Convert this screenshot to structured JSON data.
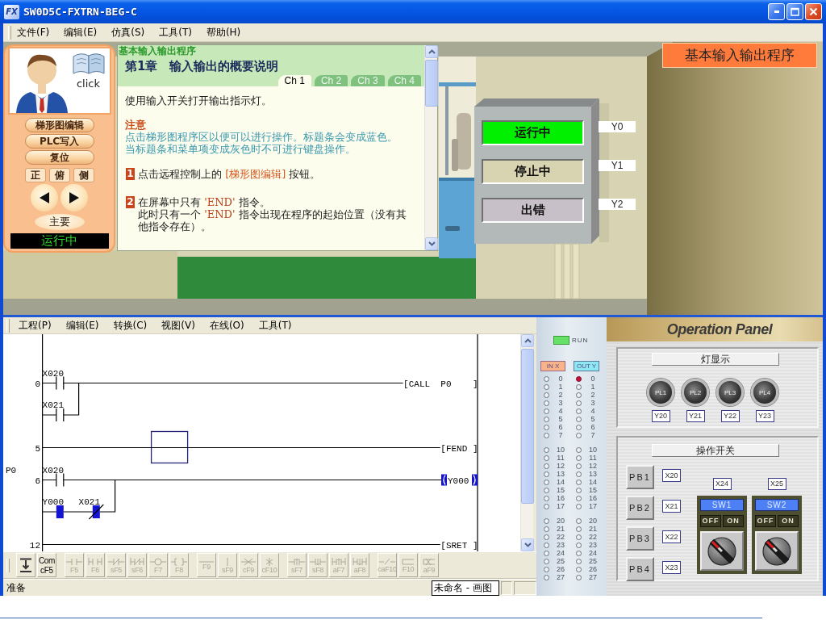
{
  "window": {
    "logo": "FX",
    "title": "SW0D5C-FXTRN-BEG-C"
  },
  "menu": [
    "文件(F)",
    "编辑(E)",
    "仿真(S)",
    "工具(T)",
    "帮助(H)"
  ],
  "remote": {
    "caption": "click",
    "buttons": [
      "梯形图编辑",
      "PLC写入",
      "复位"
    ],
    "views": [
      "正",
      "俯",
      "侧"
    ],
    "nav": [
      {
        "kind": "back"
      },
      {
        "kind": "forward"
      }
    ],
    "main_button": "主要",
    "status": "运行中"
  },
  "guide": {
    "section": "基本输入输出程序",
    "title": "第1章　输入输出的概要说明",
    "tabs": [
      {
        "label": "Ch 1",
        "selected": true
      },
      {
        "label": "Ch 2",
        "selected": false
      },
      {
        "label": "Ch 3",
        "selected": false
      },
      {
        "label": "Ch 4",
        "selected": false
      }
    ],
    "intro": "使用输入开关打开输出指示灯。",
    "note": {
      "heading": "注意",
      "lines": [
        "点击梯形图程序区以便可以进行操作。标题条会变成蓝色。",
        "当标题条和菜单项变成灰色时不可进行键盘操作。"
      ]
    },
    "steps": [
      {
        "number": "1",
        "paragraphs": [
          [
            {
              "kind": "plain",
              "text": "点击远程控制上的 "
            },
            {
              "kind": "button",
              "text": "[梯形图编辑]"
            },
            {
              "kind": "plain",
              "text": " 按钮。"
            }
          ]
        ]
      },
      {
        "number": "2",
        "paragraphs": [
          [
            {
              "kind": "plain",
              "text": "在屏幕中只有 "
            },
            {
              "kind": "code",
              "text": "'END'"
            },
            {
              "kind": "plain",
              "text": " 指令。"
            }
          ],
          [
            {
              "kind": "plain",
              "text": "此时只有一个 "
            },
            {
              "kind": "code",
              "text": "'END'"
            },
            {
              "kind": "plain",
              "text": " 指令出现在程序的起始位置（没有其他指令存在）。"
            }
          ]
        ]
      }
    ]
  },
  "scene": {
    "badge": "基本输入输出程序",
    "lamps": [
      {
        "label": "运行中",
        "address": "Y0",
        "color": "#00f000"
      },
      {
        "label": "停止中",
        "address": "Y1",
        "color": "#d8d4b2"
      },
      {
        "label": "出错",
        "address": "Y2",
        "color": "#c8c0c8"
      }
    ]
  },
  "ladder": {
    "menu": [
      "工程(P)",
      "编辑(E)",
      "转换(C)",
      "视图(V)",
      "在线(O)",
      "工具(T)"
    ],
    "rungs": [
      {
        "step": "0",
        "contacts": [
          {
            "device": "X020",
            "kind": "no",
            "on": false
          }
        ],
        "branch": [
          {
            "device": "X021",
            "kind": "no",
            "on": false
          }
        ],
        "output": {
          "kind": "function",
          "text": "[CALL  P0    ]"
        },
        "cursor": false
      },
      {
        "step": "5",
        "output": {
          "kind": "function",
          "text": "[FEND ]"
        },
        "cursor": true
      },
      {
        "pointer": "P0",
        "step": "6",
        "contacts": [
          {
            "device": "X020",
            "kind": "no",
            "on": false
          }
        ],
        "branch": [
          {
            "device": "Y000",
            "kind": "no",
            "on": true
          },
          {
            "device": "X021",
            "kind": "nc",
            "on": true
          }
        ],
        "output": {
          "kind": "coil",
          "device": "Y000",
          "on": true
        },
        "cursor": false
      },
      {
        "step": "12",
        "output": {
          "kind": "function",
          "text": "[SRET ]"
        },
        "cursor": false
      }
    ]
  },
  "toolbar": {
    "groups": [
      [
        {
          "kind": "arrow",
          "disabled": false
        },
        {
          "kind": "caption",
          "caption": "Com",
          "label": "cF5",
          "disabled": false
        }
      ],
      [
        {
          "kind": "contact",
          "label": "F5",
          "disabled": true
        },
        {
          "kind": "parallel-contact",
          "label": "F6",
          "disabled": true
        },
        {
          "kind": "closed-contact",
          "label": "sF5",
          "disabled": true
        },
        {
          "kind": "parallel-closed-contact",
          "label": "sF6",
          "disabled": true
        },
        {
          "kind": "coil",
          "label": "F7",
          "disabled": true
        },
        {
          "kind": "function",
          "label": "F8",
          "disabled": true
        }
      ],
      [
        {
          "kind": "hline",
          "label": "F9",
          "disabled": true
        },
        {
          "kind": "vline",
          "label": "sF9",
          "disabled": true
        },
        {
          "kind": "delete-hline",
          "label": "cF9",
          "disabled": true
        },
        {
          "kind": "delete-vline",
          "label": "cF10",
          "disabled": true
        }
      ],
      [
        {
          "kind": "rising-contact",
          "label": "sF7",
          "disabled": true
        },
        {
          "kind": "falling-contact",
          "label": "sF8",
          "disabled": true
        },
        {
          "kind": "parallel-rising-contact",
          "label": "aF7",
          "disabled": true
        },
        {
          "kind": "parallel-falling-contact",
          "label": "aF8",
          "disabled": true
        }
      ],
      [
        {
          "kind": "invert",
          "label": "caF10",
          "disabled": true
        },
        {
          "kind": "line",
          "label": "F10",
          "disabled": true
        },
        {
          "kind": "delete-line",
          "label": "aF9",
          "disabled": true
        }
      ]
    ]
  },
  "status_bar": {
    "text": "准备",
    "tooltip": "未命名 - 画图"
  },
  "io_monitor": {
    "run": {
      "label": "RUN",
      "on": true
    },
    "input_header": "IN X",
    "output_header": "OUT Y",
    "groups": [
      {
        "inputs": [
          {
            "label": "0",
            "on": false
          },
          {
            "label": "1",
            "on": false
          },
          {
            "label": "2",
            "on": false
          },
          {
            "label": "3",
            "on": false
          },
          {
            "label": "4",
            "on": false
          },
          {
            "label": "5",
            "on": false
          },
          {
            "label": "6",
            "on": false
          },
          {
            "label": "7",
            "on": false
          }
        ],
        "outputs": [
          {
            "label": "0",
            "on": true
          },
          {
            "label": "1",
            "on": false
          },
          {
            "label": "2",
            "on": false
          },
          {
            "label": "3",
            "on": false
          },
          {
            "label": "4",
            "on": false
          },
          {
            "label": "5",
            "on": false
          },
          {
            "label": "6",
            "on": false
          },
          {
            "label": "7",
            "on": false
          }
        ]
      },
      {
        "inputs": [
          {
            "label": "10",
            "on": false
          },
          {
            "label": "11",
            "on": false
          },
          {
            "label": "12",
            "on": false
          },
          {
            "label": "13",
            "on": false
          },
          {
            "label": "14",
            "on": false
          },
          {
            "label": "15",
            "on": false
          },
          {
            "label": "16",
            "on": false
          },
          {
            "label": "17",
            "on": false
          }
        ],
        "outputs": [
          {
            "label": "10",
            "on": false
          },
          {
            "label": "11",
            "on": false
          },
          {
            "label": "12",
            "on": false
          },
          {
            "label": "13",
            "on": false
          },
          {
            "label": "14",
            "on": false
          },
          {
            "label": "15",
            "on": false
          },
          {
            "label": "16",
            "on": false
          },
          {
            "label": "17",
            "on": false
          }
        ]
      },
      {
        "inputs": [
          {
            "label": "20",
            "on": false
          },
          {
            "label": "21",
            "on": false
          },
          {
            "label": "22",
            "on": false
          },
          {
            "label": "23",
            "on": false
          },
          {
            "label": "24",
            "on": false
          },
          {
            "label": "25",
            "on": false
          },
          {
            "label": "26",
            "on": false
          },
          {
            "label": "27",
            "on": false
          }
        ],
        "outputs": [
          {
            "label": "20",
            "on": false
          },
          {
            "label": "21",
            "on": false
          },
          {
            "label": "22",
            "on": false
          },
          {
            "label": "23",
            "on": false
          },
          {
            "label": "24",
            "on": false
          },
          {
            "label": "25",
            "on": false
          },
          {
            "label": "26",
            "on": false
          },
          {
            "label": "27",
            "on": false
          }
        ]
      }
    ]
  },
  "operation_panel": {
    "title": "Operation Panel",
    "lamps": {
      "heading": "灯显示",
      "items": [
        {
          "label": "PL1",
          "address": "Y20",
          "on": false
        },
        {
          "label": "PL2",
          "address": "Y21",
          "on": false
        },
        {
          "label": "PL3",
          "address": "Y22",
          "on": false
        },
        {
          "label": "PL4",
          "address": "Y23",
          "on": false
        }
      ]
    },
    "switches": {
      "heading": "操作开关",
      "push_buttons": [
        {
          "label": "PB1",
          "address": "X20"
        },
        {
          "label": "PB2",
          "address": "X21"
        },
        {
          "label": "PB3",
          "address": "X22"
        },
        {
          "label": "PB4",
          "address": "X23"
        }
      ],
      "selectors": [
        {
          "label": "SW1",
          "address": "X24",
          "positions": [
            "OFF",
            "ON"
          ],
          "on": false
        },
        {
          "label": "SW2",
          "address": "X25",
          "positions": [
            "OFF",
            "ON"
          ],
          "on": false
        }
      ]
    }
  }
}
